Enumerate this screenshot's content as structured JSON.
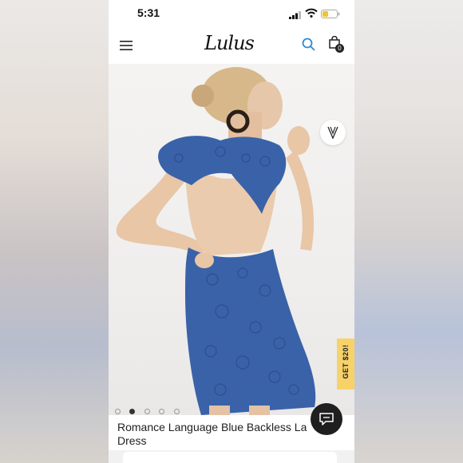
{
  "status_bar": {
    "time": "5:31"
  },
  "header": {
    "logo": "Lulus",
    "bag_count": "0",
    "icons": [
      "menu-icon",
      "search-icon",
      "shopping-bag-icon"
    ]
  },
  "product": {
    "title": "Romance Language Blue Backless La Dress",
    "image_count": 5,
    "active_image": 2,
    "promo_tab": "GET $20!",
    "dress_color": "#3a62a8"
  },
  "colors": {
    "accent_blue": "#2a8ad8",
    "promo_yellow": "#f7d26a",
    "battery_yellow": "#f2c230",
    "chat_button": "#1f1f1f"
  }
}
